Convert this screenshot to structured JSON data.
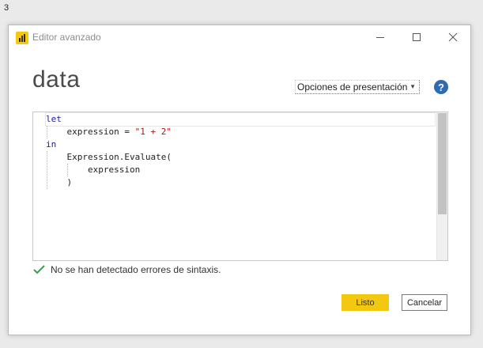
{
  "corner_label": "3",
  "window": {
    "title": "Editor avanzado",
    "logo_color": "#f2c811"
  },
  "query_title": "data",
  "toolbar": {
    "display_options_label": "Opciones de presentación",
    "help_label": "?"
  },
  "editor": {
    "lines": [
      {
        "keyword": "let",
        "text": ""
      },
      {
        "keyword": "",
        "prefix": "    expression = ",
        "string": "\"1 + 2\""
      },
      {
        "keyword": "in",
        "text": ""
      },
      {
        "keyword": "",
        "text": "    Expression.Evaluate("
      },
      {
        "keyword": "",
        "text": "        expression"
      },
      {
        "keyword": "",
        "text": "    )"
      }
    ]
  },
  "status": {
    "message": "No se han detectado errores de sintaxis.",
    "icon": "check-icon",
    "color": "#3e9b55"
  },
  "buttons": {
    "done_label": "Listo",
    "cancel_label": "Cancelar"
  }
}
